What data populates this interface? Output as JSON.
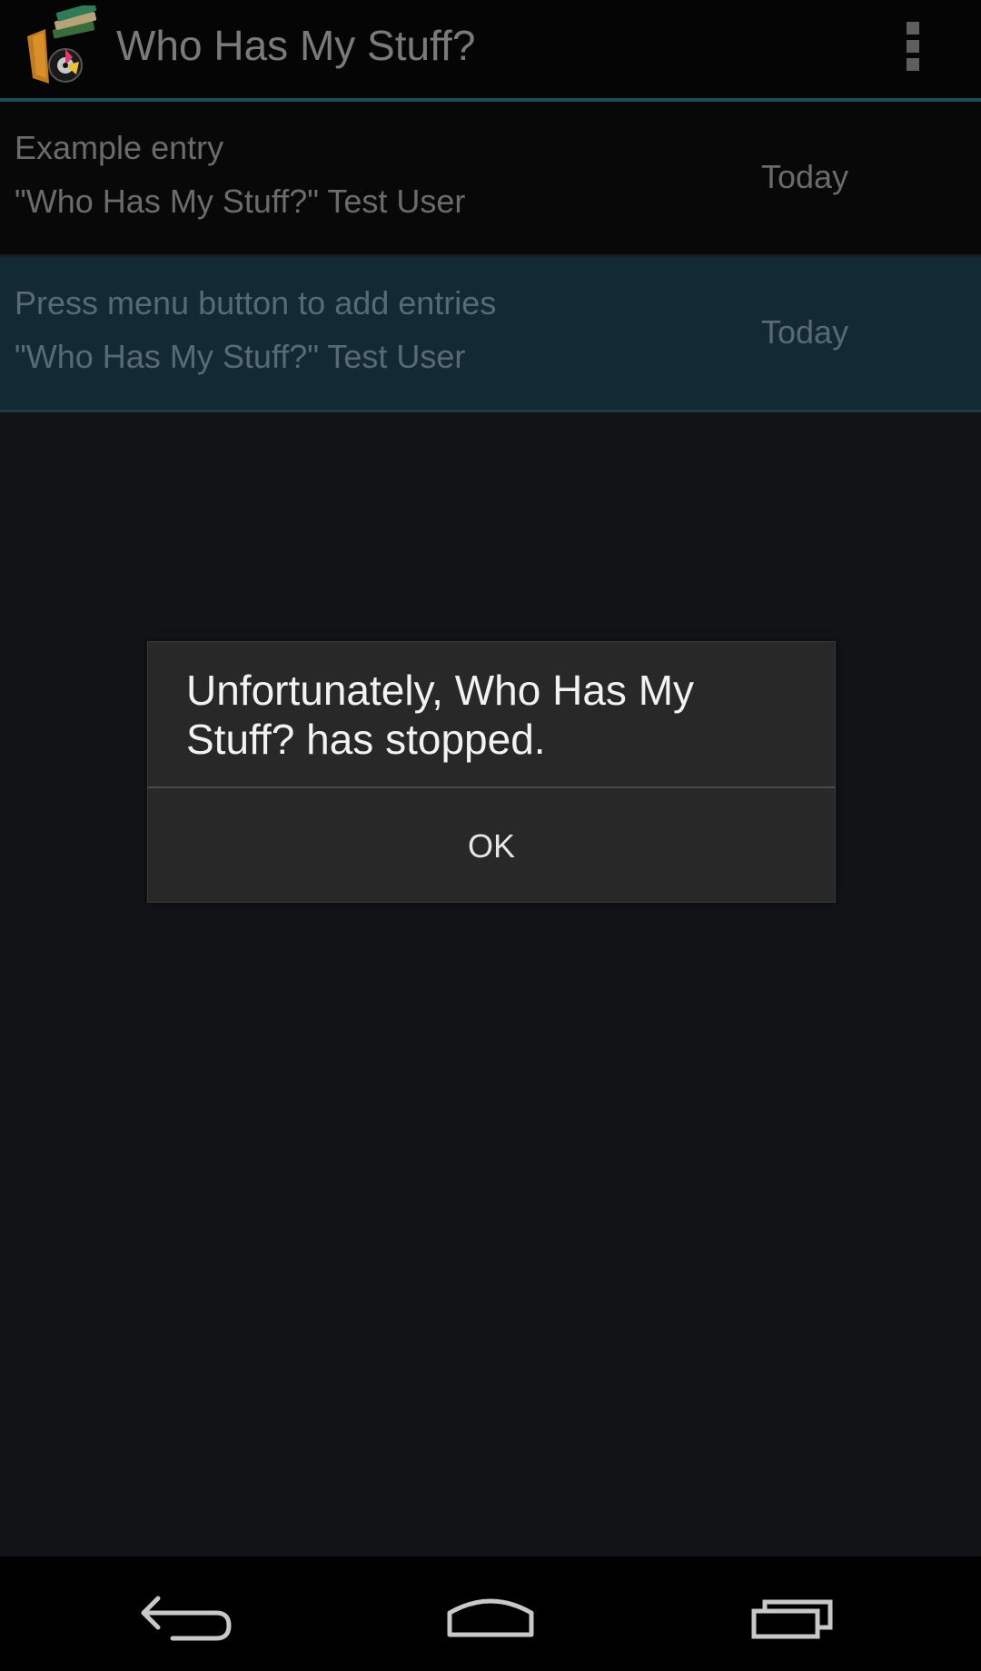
{
  "action_bar": {
    "title": "Who Has My Stuff?",
    "app_icon": "books-app-icon",
    "overflow_icon": "overflow-menu-icon"
  },
  "entries": [
    {
      "title": "Example entry",
      "owner": "\"Who Has My Stuff?\" Test User",
      "date": "Today",
      "selected": false
    },
    {
      "title": "Press menu button to add entries",
      "owner": "\"Who Has My Stuff?\" Test User",
      "date": "Today",
      "selected": true
    }
  ],
  "dialog": {
    "message": "Unfortunately, Who Has My Stuff? has stopped.",
    "ok_label": "OK"
  },
  "nav_bar": {
    "back_icon": "back-icon",
    "home_icon": "home-icon",
    "recents_icon": "recents-icon"
  },
  "colors": {
    "accent": "#1f4a57",
    "selected_row": "#132a35",
    "dialog_bg": "#282828"
  }
}
